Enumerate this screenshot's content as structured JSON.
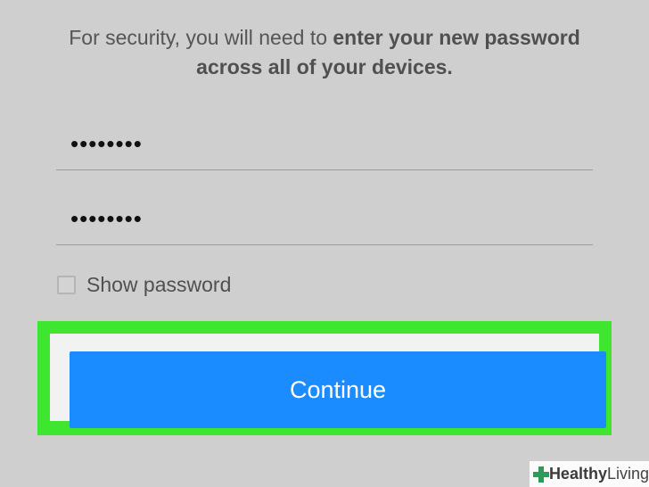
{
  "message": {
    "prefix": "For security, you will need to ",
    "bold": "enter your new password across all of your devices."
  },
  "fields": [
    {
      "value_mask": "••••••••"
    },
    {
      "value_mask": "••••••••"
    }
  ],
  "show_password": {
    "label": "Show password",
    "checked": false
  },
  "continue_label": "Continue",
  "colors": {
    "background": "#cfcfcf",
    "button": "#1a8cff",
    "highlight": "#3ee62f",
    "brand": "#2f9a5a"
  },
  "watermark": {
    "part1": "Healthy",
    "part2": "Living"
  }
}
